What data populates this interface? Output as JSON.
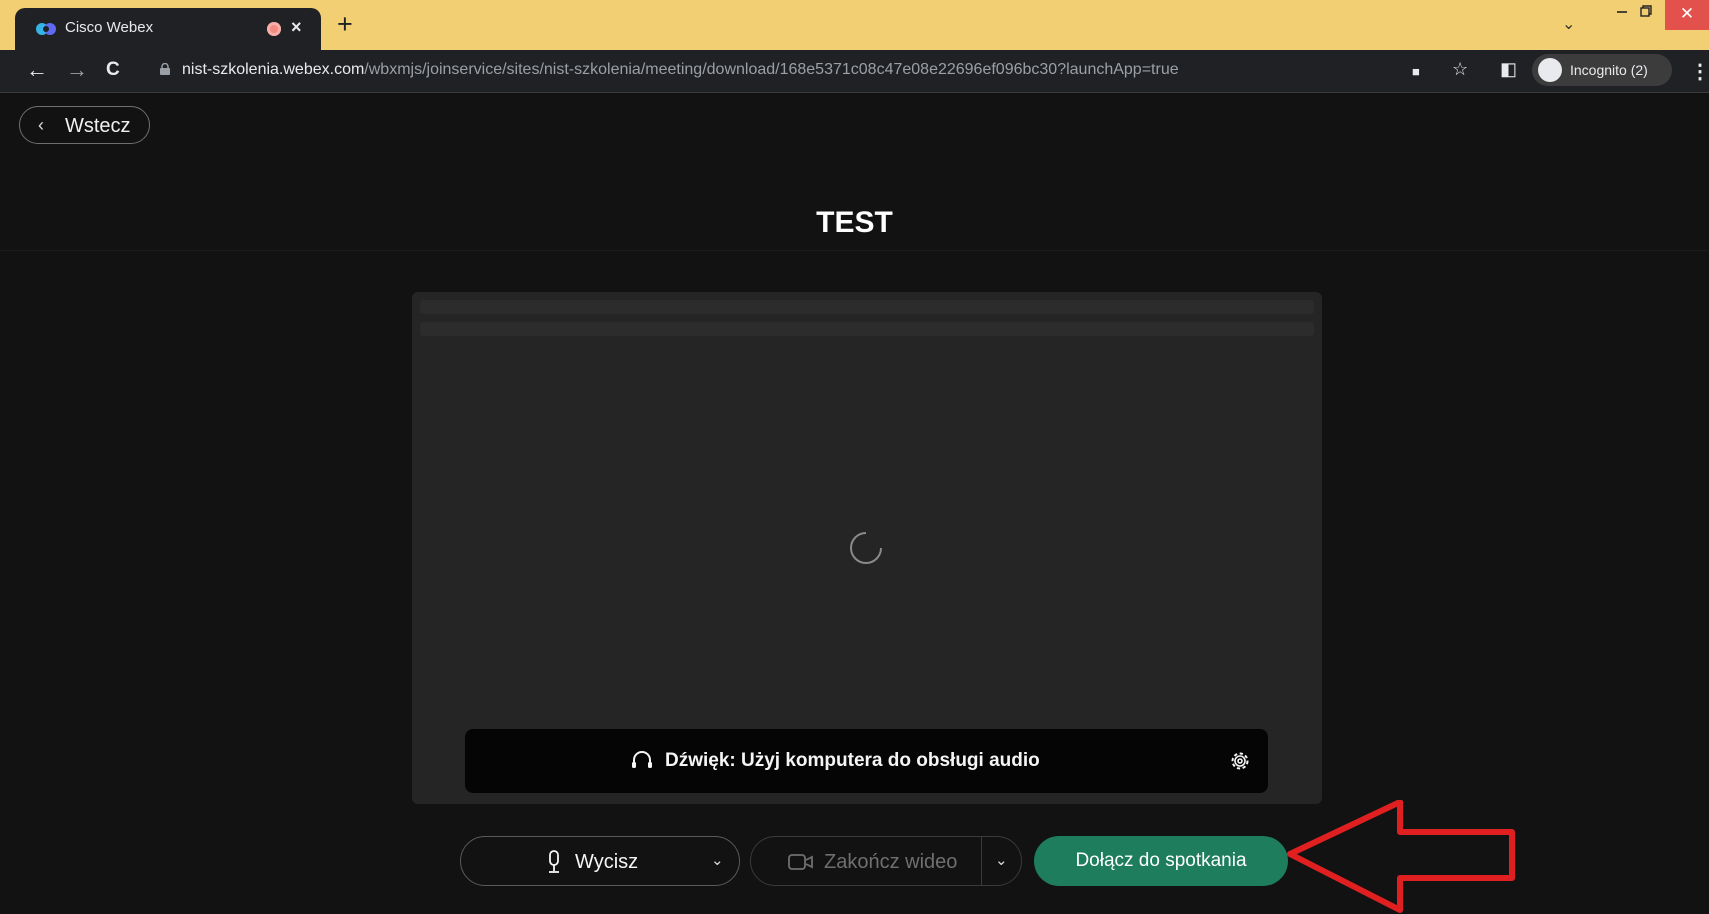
{
  "browser": {
    "tab_title": "Cisco Webex",
    "tab_close": "×",
    "new_tab": "+",
    "url_host": "nist-szkolenia.webex.com",
    "url_path": "/wbxmjs/joinservice/sites/nist-szkolenia/meeting/download/168e5371c08c47e08e22696ef096bc30?launchApp=true",
    "incognito_label": "Incognito (2)",
    "close_glyph": "✕",
    "nav_icons": {
      "back": "←",
      "forward": "→",
      "reload": "C"
    },
    "toolbar_icons": {
      "camera": "■",
      "star": "☆",
      "sidepanel": "◧",
      "menu": "⋮"
    }
  },
  "page": {
    "back_label": "Wstecz",
    "back_chevron": "‹",
    "meeting_title": "TEST",
    "audio_text": "Dźwięk: Użyj komputera do obsługi audio",
    "mute_label": "Wycisz",
    "video_label": "Zakończ wideo",
    "join_label": "Dołącz do spotkania",
    "chevron": "⌄"
  },
  "colors": {
    "title_bar": "#f2cf73",
    "background": "#121212",
    "join_button": "#1d7d5c",
    "annotation_arrow": "#e02020"
  },
  "icons": [
    "webex-logo-icon",
    "record-icon",
    "lock-icon",
    "camera-icon",
    "star-icon",
    "sidepanel-icon",
    "incognito-icon",
    "spinner-icon",
    "headset-icon",
    "gear-icon",
    "microphone-icon",
    "video-camera-icon",
    "chevron-down-icon",
    "red-arrow-annotation"
  ]
}
